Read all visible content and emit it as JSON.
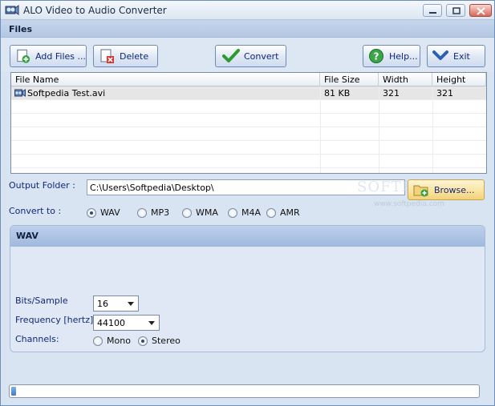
{
  "window": {
    "title": "ALO Video to Audio Converter"
  },
  "files_section": {
    "title": "Files"
  },
  "toolbar": {
    "add_files": "Add Files ...",
    "delete": "Delete",
    "convert": "Convert",
    "help": "Help...",
    "exit": "Exit"
  },
  "file_list": {
    "columns": [
      "File Name",
      "File Size",
      "Width",
      "Height"
    ],
    "rows": [
      {
        "name": "Softpedia Test.avi",
        "size": "81 KB",
        "width": "321",
        "height": "321"
      }
    ]
  },
  "output": {
    "label": "Output Folder :",
    "path": "C:\\Users\\Softpedia\\Desktop\\",
    "browse": "Browse..."
  },
  "convert_to": {
    "label": "Convert to :",
    "options": [
      "WAV",
      "MP3",
      "WMA",
      "M4A",
      "AMR"
    ],
    "selected": "WAV"
  },
  "wav_panel": {
    "title": "WAV",
    "bits_label": "Bits/Sample",
    "bits_value": "16",
    "freq_label": "Frequency [hertz]",
    "freq_value": "44100",
    "channels_label": "Channels:",
    "channel_mono": "Mono",
    "channel_stereo": "Stereo",
    "channel_selected": "Stereo"
  },
  "watermark": {
    "text": "SOFTPEDIA",
    "url": "www.softpedia.com"
  },
  "progress": {
    "value": 0.01
  },
  "colors": {
    "accent": "#10287a",
    "window_bg": "#d9e4f2",
    "header_bg": "#b3c8e4"
  }
}
